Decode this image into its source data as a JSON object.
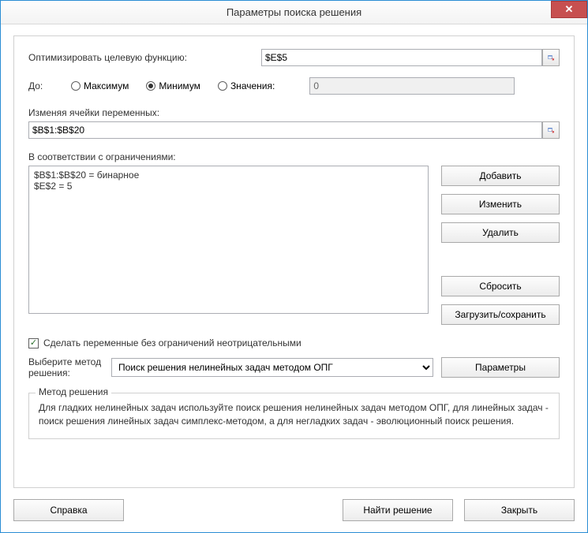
{
  "title": "Параметры поиска решения",
  "close_glyph": "✕",
  "objective": {
    "label": "Оптимизировать целевую функцию:",
    "value": "$E$5"
  },
  "to": {
    "label": "До:",
    "options": {
      "max": "Максимум",
      "min": "Минимум",
      "value": "Значения:"
    },
    "selected": "min",
    "value_input": "0"
  },
  "var_cells": {
    "label": "Изменяя ячейки переменных:",
    "value": "$B$1:$B$20"
  },
  "constraints": {
    "label": "В соответствии с ограничениями:",
    "items": [
      "$B$1:$B$20 = бинарное",
      "$E$2 = 5"
    ]
  },
  "side_buttons": {
    "add": "Добавить",
    "change": "Изменить",
    "delete": "Удалить",
    "reset": "Сбросить",
    "load_save": "Загрузить/сохранить"
  },
  "nonneg": {
    "checked": true,
    "label": "Сделать переменные без ограничений неотрицательными"
  },
  "method": {
    "label": "Выберите метод решения:",
    "selected": "Поиск решения нелинейных задач методом ОПГ",
    "params_btn": "Параметры"
  },
  "method_box": {
    "legend": "Метод решения",
    "desc": "Для гладких нелинейных задач используйте поиск решения нелинейных задач методом ОПГ, для линейных задач - поиск решения линейных задач симплекс-методом, а для негладких задач - эволюционный поиск решения."
  },
  "bottom": {
    "help": "Справка",
    "solve": "Найти решение",
    "close": "Закрыть"
  }
}
